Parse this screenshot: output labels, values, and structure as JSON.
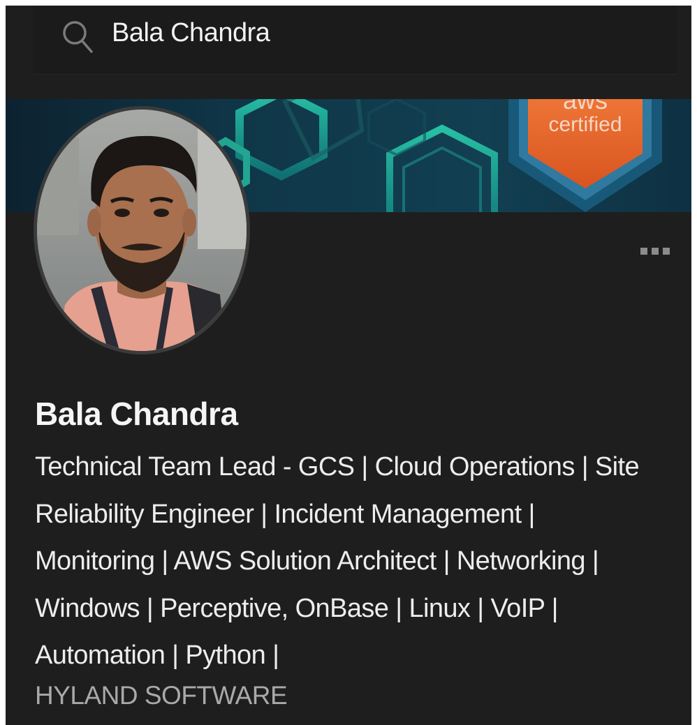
{
  "search": {
    "query": "Bala Chandra",
    "icon": "search-icon"
  },
  "banner": {
    "badge_text_top": "aws",
    "badge_text": "certified",
    "colors": {
      "background": "#0f3a4c",
      "hexagon_teal": "#1fa48f",
      "badge_orange": "#e8672e"
    }
  },
  "actions": {
    "more_icon": "more-horizontal-icon"
  },
  "profile": {
    "avatar_icon": "avatar",
    "name": "Bala Chandra",
    "headline_lines": [
      "Technical Team Lead - GCS | Cloud Operations | Site",
      "Reliability Engineer | Incident Management |",
      "Monitoring | AWS Solution Architect | Networking |",
      "Windows | Perceptive, OnBase | Linux | VoIP |",
      "Automation | Python |"
    ],
    "company": "HYLAND SOFTWARE"
  },
  "colors": {
    "page_background": "#1e1e1f",
    "text_primary": "#f5f5f5",
    "text_secondary": "#a9a9a9"
  }
}
